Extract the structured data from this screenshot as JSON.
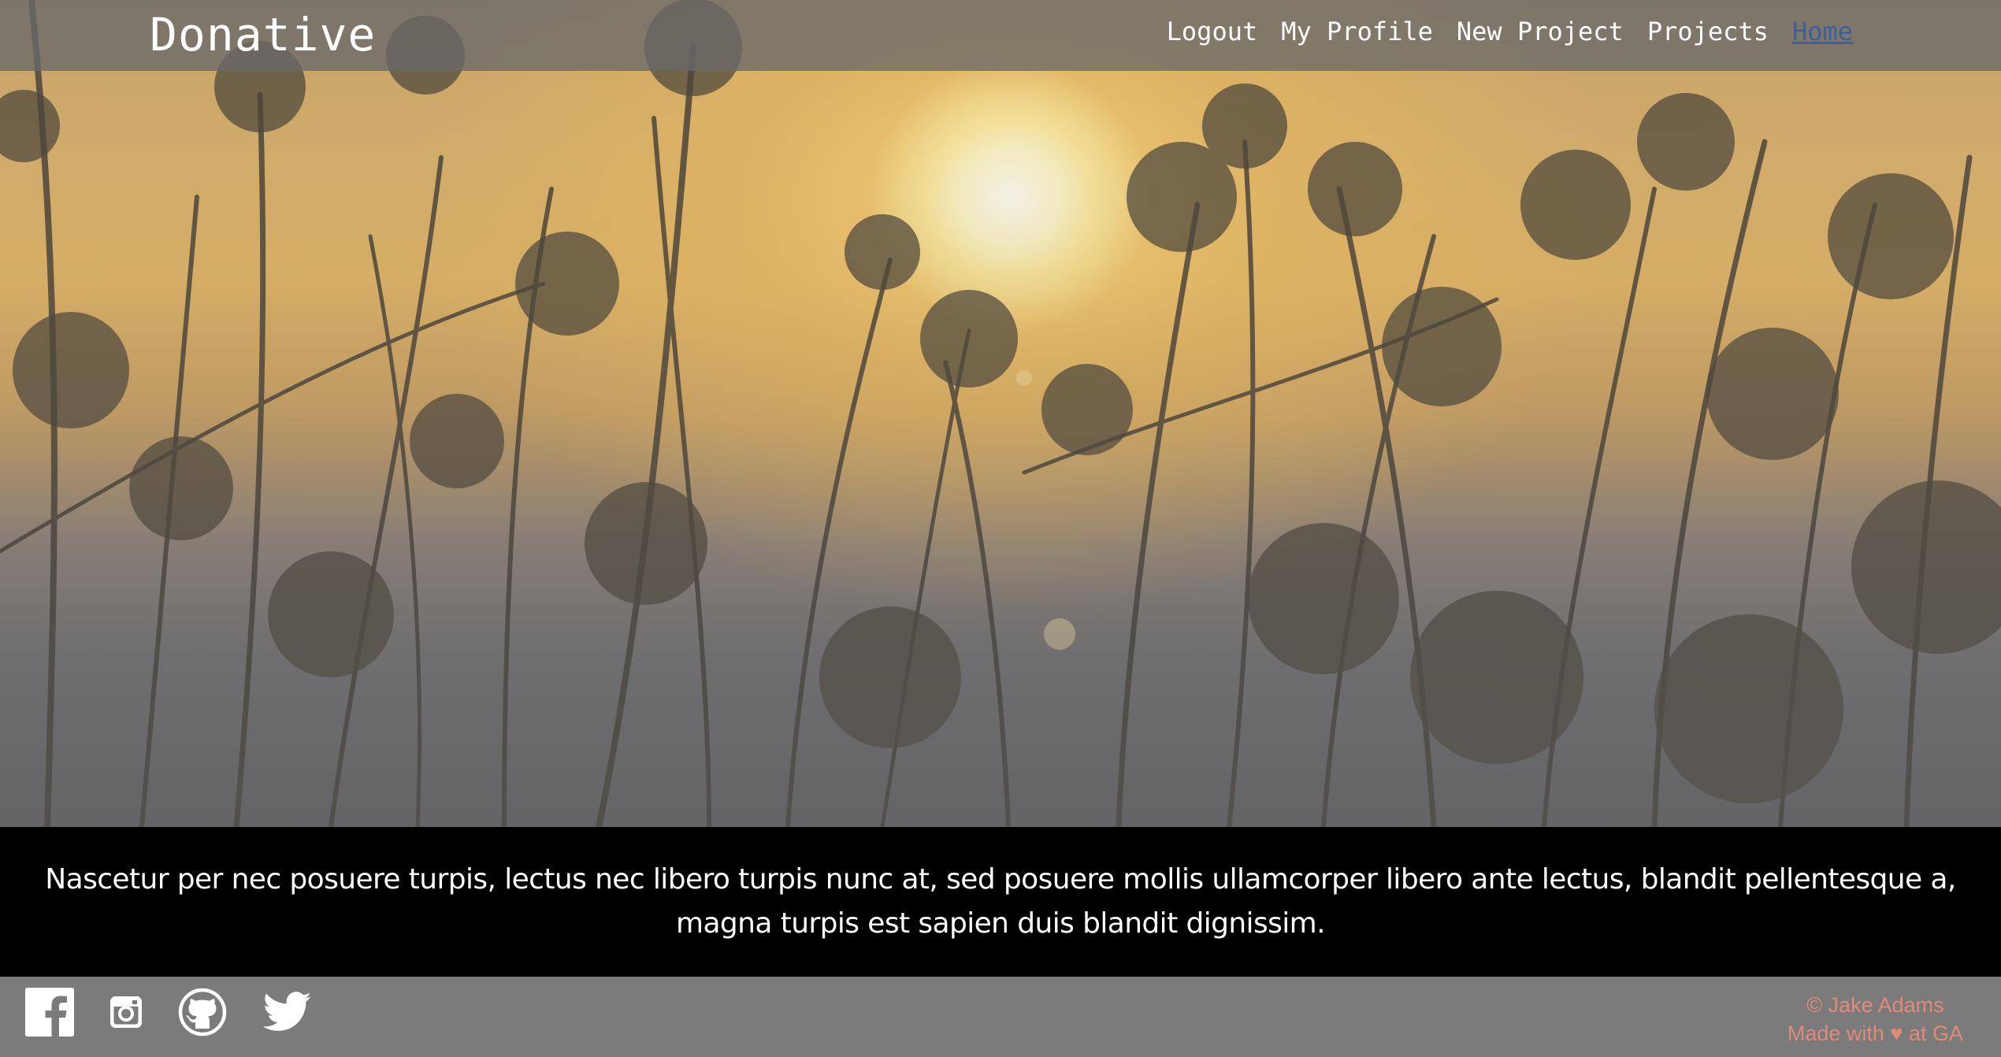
{
  "navbar": {
    "brand": "Donative",
    "links": [
      {
        "label": "Logout"
      },
      {
        "label": "My Profile"
      },
      {
        "label": "New Project"
      },
      {
        "label": "Projects"
      },
      {
        "label": "Home",
        "active": true
      }
    ]
  },
  "hero": {
    "background": "sunset-flowers-photo"
  },
  "tagline": {
    "text": "Nascetur per nec posuere turpis, lectus nec libero turpis nunc at, sed posuere mollis ullamcorper libero ante lectus, blandit pellentesque a, magna turpis est sapien duis blandit dignissim."
  },
  "footer": {
    "social": [
      {
        "icon": "facebook-icon"
      },
      {
        "icon": "instagram-icon"
      },
      {
        "icon": "github-icon"
      },
      {
        "icon": "twitter-icon"
      }
    ],
    "copyright": "© Jake Adams",
    "made_with": "Made with ♥ at GA"
  },
  "colors": {
    "navbar_bg": "#696969",
    "footer_bg": "#7b7b7b",
    "tagline_bg": "#000000",
    "active_link": "#3b5fa0",
    "credits_text": "#e08a77"
  }
}
